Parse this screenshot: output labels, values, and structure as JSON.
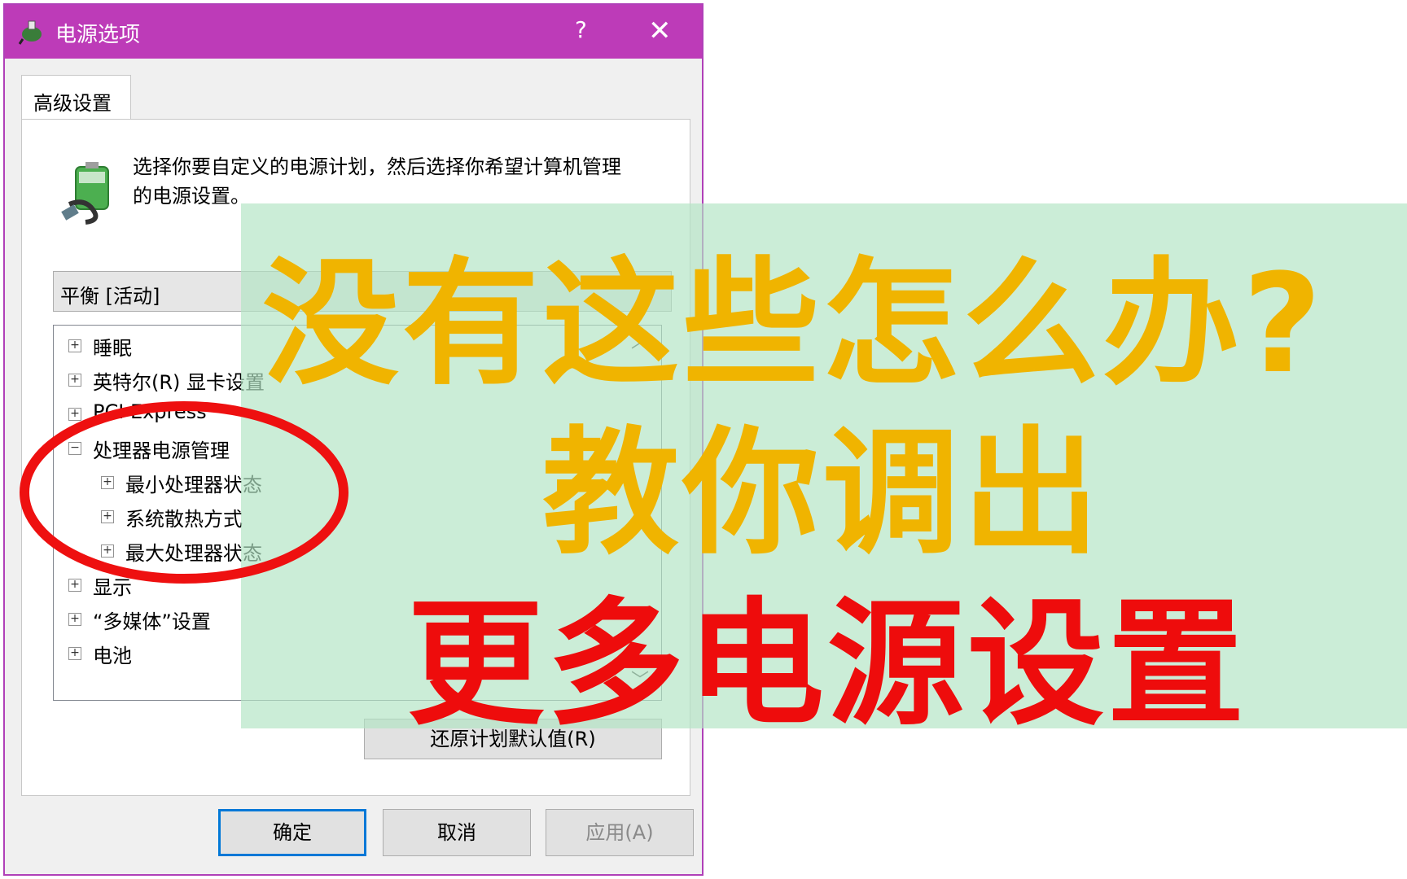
{
  "window": {
    "title": "电源选项",
    "help_label": "?",
    "close_label": "✕",
    "titlebar_color": "#bd3bb8"
  },
  "tab": {
    "label": "高级设置"
  },
  "description": {
    "line1": "选择你要自定义的电源计划，然后选择你希望计算机管理",
    "line2": "的电源设置。"
  },
  "plan_select": {
    "value": "平衡 [活动]"
  },
  "tree": {
    "items": [
      {
        "expander": "+",
        "label": "睡眠"
      },
      {
        "expander": "+",
        "label": "英特尔(R) 显卡设置"
      },
      {
        "expander": "+",
        "label": "PCI Express"
      },
      {
        "expander": "−",
        "label": "处理器电源管理"
      },
      {
        "expander": "+",
        "label": "最小处理器状态"
      },
      {
        "expander": "+",
        "label": "系统散热方式"
      },
      {
        "expander": "+",
        "label": "最大处理器状态"
      },
      {
        "expander": "+",
        "label": "显示"
      },
      {
        "expander": "+",
        "label": "“多媒体”设置"
      },
      {
        "expander": "+",
        "label": "电池"
      }
    ]
  },
  "restore_button": {
    "label": "还原计划默认值(R)"
  },
  "buttons": {
    "ok": "确定",
    "cancel": "取消",
    "apply": "应用(A)"
  },
  "overlay": {
    "line1": "没有这些怎么办?",
    "line2": "教你调出",
    "line3": "更多电源设置",
    "color_yellow": "#f0b400",
    "color_red": "#ee0c0c"
  }
}
